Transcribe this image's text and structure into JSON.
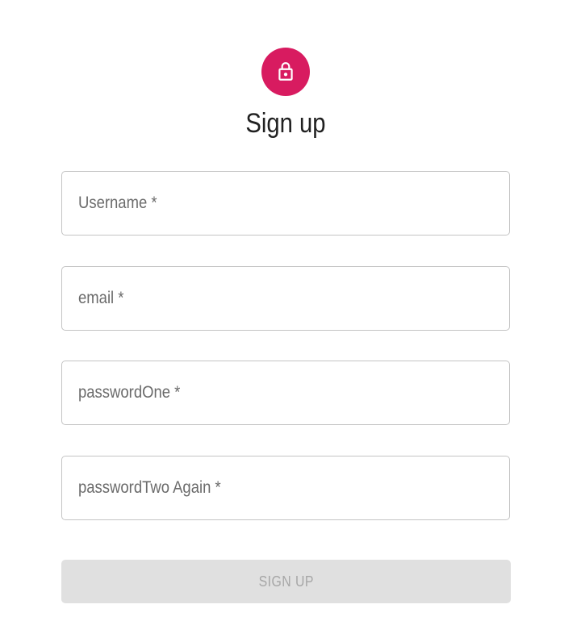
{
  "header": {
    "icon": "lock-icon",
    "title": "Sign up"
  },
  "form": {
    "fields": [
      {
        "label": "Username *",
        "value": ""
      },
      {
        "label": "email *",
        "value": ""
      },
      {
        "label": "passwordOne *",
        "value": ""
      },
      {
        "label": "passwordTwo Again *",
        "value": ""
      }
    ],
    "submit_label": "SIGN UP",
    "submit_disabled": true
  },
  "colors": {
    "accent": "#d81b60",
    "field_border": "#c4c4c4",
    "label_text": "#6b6b6b",
    "disabled_button_bg": "#e0e0e0",
    "disabled_button_text": "#a6a6a6"
  }
}
